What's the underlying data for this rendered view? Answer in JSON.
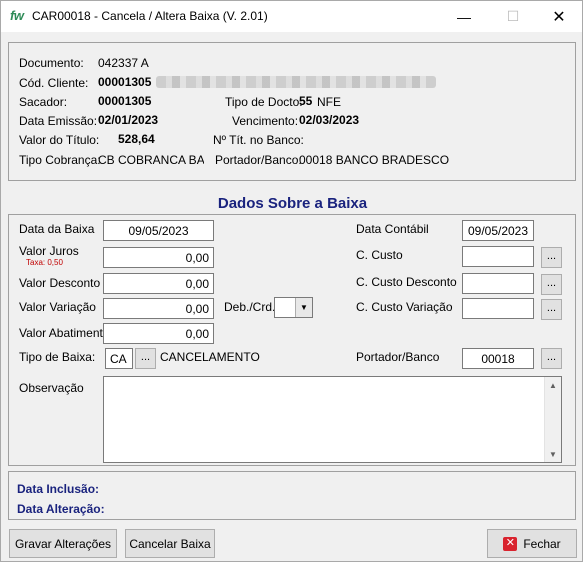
{
  "window": {
    "app_icon": "fw",
    "title": "CAR00018 - Cancela / Altera Baixa  (V. 2.01)",
    "min_glyph": "—",
    "max_glyph": "☐",
    "close_glyph": "✕"
  },
  "header": {
    "documento_label": "Documento:",
    "documento_value": "042337   A",
    "cod_cliente_label": "Cód. Cliente:",
    "cod_cliente_value": "00001305",
    "sacador_label": "Sacador:",
    "sacador_value": "00001305",
    "tipo_docto_label": "Tipo de Docto:",
    "tipo_docto_num": "55",
    "tipo_docto_text": "NFE",
    "data_emissao_label": "Data Emissão:",
    "data_emissao_value": "02/01/2023",
    "vencimento_label": "Vencimento:",
    "vencimento_value": "02/03/2023",
    "valor_titulo_label": "Valor do Título:",
    "valor_titulo_value": "528,64",
    "num_tit_banco_label": "Nº Tít. no Banco:",
    "tipo_cobranca_label": "Tipo Cobrança:",
    "tipo_cobranca_value": "CB  COBRANCA BANI",
    "portador_banco_label": "Portador/Banco:",
    "portador_banco_value": "00018  BANCO BRADESCO"
  },
  "baixa": {
    "section_title": "Dados Sobre a Baixa",
    "data_baixa_label": "Data da Baixa",
    "data_baixa_value": "09/05/2023",
    "valor_juros_label": "Valor Juros",
    "taxa_label": "Taxa: 0,50",
    "valor_juros_value": "0,00",
    "valor_desconto_label": "Valor Desconto",
    "valor_desconto_value": "0,00",
    "valor_variacao_label": "Valor Variação",
    "valor_variacao_value": "0,00",
    "deb_crd_label": "Deb./Crd.",
    "deb_crd_value": "",
    "valor_abatimento_label": "Valor Abatimento:",
    "valor_abatimento_value": "0,00",
    "tipo_baixa_label": "Tipo de Baixa:",
    "tipo_baixa_code": "CA",
    "tipo_baixa_text": "CANCELAMENTO",
    "data_contabil_label": "Data Contábil",
    "data_contabil_value": "09/05/2023",
    "c_custo_label": "C. Custo",
    "c_custo_value": "",
    "c_custo_desconto_label": "C. Custo Desconto",
    "c_custo_desconto_value": "",
    "c_custo_variacao_label": "C. Custo Variação",
    "c_custo_variacao_value": "",
    "portador_banco_label": "Portador/Banco",
    "portador_banco_value": "00018",
    "observacao_label": "Observação",
    "observacao_value": "",
    "lookup_glyph": "..."
  },
  "footer": {
    "data_inclusao_label": "Data Inclusão:",
    "data_alteracao_label": "Data Alteração:"
  },
  "buttons": {
    "gravar_label": "Gravar Alterações",
    "cancelar_label": "Cancelar Baixa",
    "fechar_label": "Fechar",
    "fechar_icon": "✕"
  }
}
